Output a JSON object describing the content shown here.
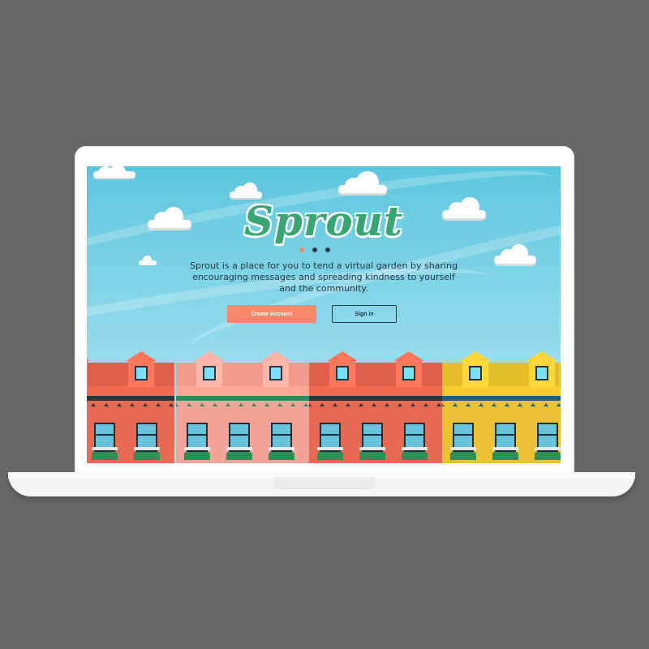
{
  "app": {
    "logo": "Sprout",
    "tagline": "Sprout is a place for you to tend a virtual garden by sharing encouraging messages and spreading kindness to yourself and the community.",
    "create_account_label": "Create Account",
    "sign_in_label": "Sign in"
  },
  "carousel": {
    "pages": 3,
    "active_index": 0,
    "colors": {
      "active": "#f5886c",
      "inactive": "#2a3a44"
    }
  },
  "colors": {
    "background": "#666666",
    "logo": "#3aa574",
    "primary_button": "#f5886c",
    "text": "#243640",
    "sky": "#5cc6df"
  },
  "houses": [
    {
      "roof": "#e0604b",
      "band": "#2b3438",
      "wall": "#e96a52"
    },
    {
      "roof": "#f29a8c",
      "band": "#2f8b5e",
      "wall": "#f4a398"
    },
    {
      "roof": "#e0604b",
      "band": "#2b3438",
      "wall": "#e96a52"
    },
    {
      "roof": "#e5be2c",
      "band": "#245a8b",
      "wall": "#ecc235"
    }
  ],
  "icons": [
    "cloud-icon",
    "dormer-window-icon",
    "window-planter-icon"
  ]
}
